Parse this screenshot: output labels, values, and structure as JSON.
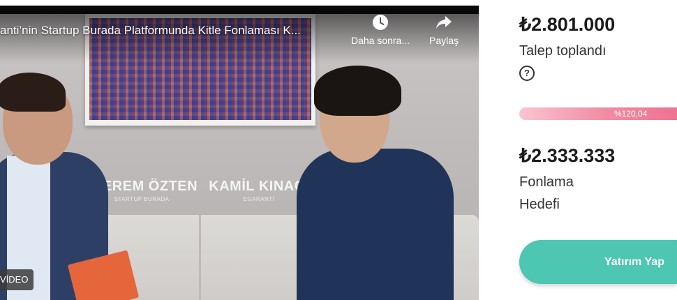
{
  "video": {
    "title": "anti’nin Startup Burada Platformunda Kitle Fonlaması K...",
    "watch_later_label": "Daha sonra...",
    "share_label": "Paylaş",
    "badge_label": "VİDEO",
    "people": [
      {
        "name": "KEREM ÖZTEN",
        "role": "STARTUP BURADA"
      },
      {
        "name": "KAMİL KINACI",
        "role": "EGARANTİ"
      }
    ],
    "icons": {
      "watch_later": "clock-icon",
      "share": "share-arrow-icon"
    }
  },
  "funding": {
    "raised_amount": "₺2.801.000",
    "raised_label": "Talep toplandı",
    "help_icon": "help-circle-icon",
    "progress_text": "%120,04",
    "progress_value_percent": 120.04,
    "goal_amount": "₺2.333.333",
    "goal_label_line1": "Fonlama",
    "goal_label_line2": "Hedefi",
    "invest_button": "Yatırım Yap",
    "colors": {
      "progress": "#ee7390",
      "button": "#4dc6b2"
    }
  }
}
